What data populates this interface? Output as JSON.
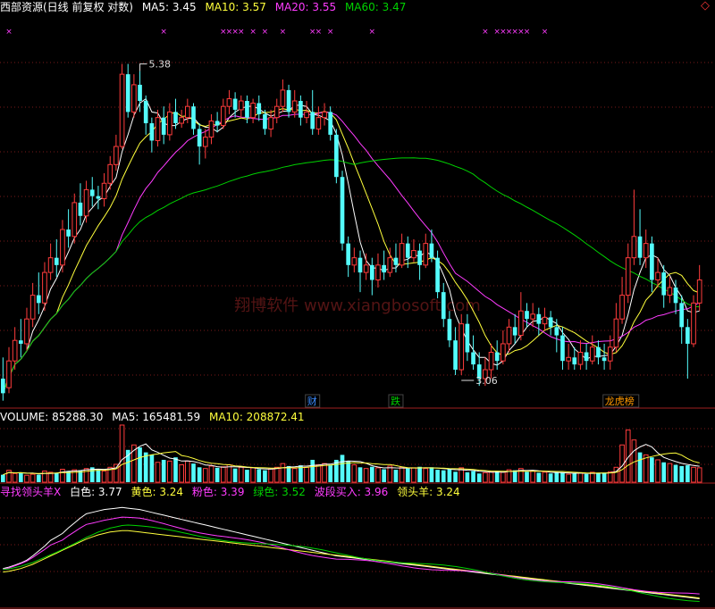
{
  "header": {
    "title": "西部资源(日线 前复权 对数)",
    "ma5": "MA5: 3.45",
    "ma10": "MA10: 3.57",
    "ma20": "MA20: 3.55",
    "ma60": "MA60: 3.47",
    "close_symbol": "◇"
  },
  "colors": {
    "up": "#ff3c3c",
    "down": "#54fcfc",
    "ma5": "#ffffff",
    "ma10": "#ffff3c",
    "ma20": "#ff3cff",
    "ma60": "#00d200",
    "grid": "#7a1a1a",
    "marker": "#ff3cff"
  },
  "annotations": {
    "high": "5.38",
    "low": "3.06",
    "watermark": "翔博软件 www.xiangbosoft.com",
    "tags": [
      {
        "text": "财",
        "color": "#3c8cff"
      },
      {
        "text": "跌",
        "color": "#00d200"
      },
      {
        "text": "龙虎榜",
        "color": "#ff9900"
      }
    ]
  },
  "volume_header": {
    "volume": "VOLUME: 85288.30",
    "ma5": "MA5: 165481.59",
    "ma10": "MA10: 208872.41"
  },
  "indicator_header": {
    "name": "寻找领头羊X",
    "white": "白色: 3.77",
    "yellow": "黄色: 3.24",
    "pink": "粉色: 3.39",
    "green": "绿色: 3.52",
    "wave_buy": "波段买入: 3.96",
    "leader": "领头羊: 3.24"
  },
  "chart_data": {
    "type": "candlestick",
    "scale": "log",
    "ylim": [
      2.95,
      5.9
    ],
    "grid": "dotted-horizontal",
    "marker_days": [
      1,
      27,
      37,
      38,
      39,
      40,
      42,
      44,
      47,
      52,
      53,
      55,
      62,
      81,
      83,
      84,
      85,
      86,
      87,
      88,
      91
    ],
    "high_label_day": 23,
    "low_label_day": 77,
    "tag_days": [
      52,
      66,
      102
    ],
    "candles": [
      [
        3.1,
        3.02,
        3.22,
        2.98
      ],
      [
        3.05,
        3.2,
        3.28,
        3.02
      ],
      [
        3.2,
        3.32,
        3.4,
        3.15
      ],
      [
        3.32,
        3.3,
        3.45,
        3.22
      ],
      [
        3.3,
        3.45,
        3.52,
        3.26
      ],
      [
        3.45,
        3.6,
        3.68,
        3.4
      ],
      [
        3.6,
        3.55,
        3.75,
        3.48
      ],
      [
        3.55,
        3.75,
        3.82,
        3.5
      ],
      [
        3.75,
        3.85,
        3.95,
        3.7
      ],
      [
        3.85,
        3.8,
        3.98,
        3.72
      ],
      [
        3.8,
        4.05,
        4.12,
        3.75
      ],
      [
        4.05,
        4.0,
        4.2,
        3.92
      ],
      [
        4.0,
        4.25,
        4.32,
        3.95
      ],
      [
        4.25,
        4.15,
        4.4,
        4.08
      ],
      [
        4.15,
        4.35,
        4.42,
        4.1
      ],
      [
        4.35,
        4.3,
        4.45,
        4.22
      ],
      [
        4.3,
        4.28,
        4.38,
        4.2
      ],
      [
        4.28,
        4.4,
        4.48,
        4.22
      ],
      [
        4.4,
        4.55,
        4.62,
        4.35
      ],
      [
        4.55,
        4.7,
        4.8,
        4.5
      ],
      [
        4.7,
        5.35,
        5.45,
        4.68
      ],
      [
        5.35,
        5.0,
        5.45,
        4.95
      ],
      [
        5.0,
        5.25,
        5.35,
        4.95
      ],
      [
        5.25,
        5.1,
        5.38,
        5.0
      ],
      [
        5.1,
        4.9,
        5.15,
        4.8
      ],
      [
        4.9,
        4.75,
        4.95,
        4.65
      ],
      [
        4.75,
        4.95,
        5.02,
        4.7
      ],
      [
        4.95,
        4.8,
        5.05,
        4.72
      ],
      [
        4.8,
        5.0,
        5.08,
        4.75
      ],
      [
        5.0,
        4.9,
        5.12,
        4.85
      ],
      [
        4.9,
        4.95,
        5.02,
        4.86
      ],
      [
        4.95,
        5.05,
        5.12,
        4.9
      ],
      [
        5.05,
        4.85,
        5.08,
        4.8
      ],
      [
        4.85,
        4.7,
        4.9,
        4.55
      ],
      [
        4.7,
        4.78,
        4.85,
        4.6
      ],
      [
        4.78,
        4.92,
        4.98,
        4.72
      ],
      [
        4.92,
        4.88,
        5.0,
        4.82
      ],
      [
        4.88,
        5.05,
        5.12,
        4.85
      ],
      [
        5.05,
        5.12,
        5.2,
        4.98
      ],
      [
        5.12,
        5.02,
        5.18,
        4.95
      ],
      [
        5.02,
        5.1,
        5.15,
        4.95
      ],
      [
        5.1,
        4.95,
        5.15,
        4.9
      ],
      [
        4.95,
        5.08,
        5.12,
        4.9
      ],
      [
        5.08,
        4.98,
        5.15,
        4.92
      ],
      [
        4.98,
        4.85,
        5.02,
        4.8
      ],
      [
        4.85,
        4.95,
        5.02,
        4.78
      ],
      [
        4.95,
        5.05,
        5.12,
        4.9
      ],
      [
        5.05,
        5.2,
        5.3,
        5.0
      ],
      [
        5.2,
        5.0,
        5.25,
        4.95
      ],
      [
        5.0,
        5.1,
        5.2,
        4.95
      ],
      [
        5.1,
        4.95,
        5.15,
        4.88
      ],
      [
        4.95,
        5.0,
        5.1,
        4.9
      ],
      [
        5.0,
        4.85,
        5.2,
        4.8
      ],
      [
        4.85,
        4.95,
        5.05,
        4.8
      ],
      [
        4.95,
        5.0,
        5.08,
        4.88
      ],
      [
        5.0,
        4.8,
        5.05,
        4.75
      ],
      [
        4.8,
        4.45,
        4.85,
        4.4
      ],
      [
        4.45,
        3.95,
        4.5,
        3.9
      ],
      [
        3.95,
        3.8,
        4.0,
        3.72
      ],
      [
        3.8,
        3.85,
        3.92,
        3.75
      ],
      [
        3.85,
        3.75,
        3.9,
        3.62
      ],
      [
        3.75,
        3.8,
        3.88,
        3.7
      ],
      [
        3.8,
        3.7,
        3.85,
        3.6
      ],
      [
        3.7,
        3.8,
        3.88,
        3.65
      ],
      [
        3.8,
        3.75,
        3.9,
        3.7
      ],
      [
        3.75,
        3.85,
        3.92,
        3.72
      ],
      [
        3.85,
        3.8,
        3.95,
        3.75
      ],
      [
        3.8,
        3.95,
        4.02,
        3.78
      ],
      [
        3.95,
        3.85,
        4.0,
        3.78
      ],
      [
        3.85,
        3.9,
        3.98,
        3.82
      ],
      [
        3.9,
        3.8,
        3.95,
        3.7
      ],
      [
        3.8,
        3.95,
        4.02,
        3.78
      ],
      [
        3.95,
        3.85,
        4.05,
        3.82
      ],
      [
        3.85,
        3.62,
        3.9,
        3.58
      ],
      [
        3.62,
        3.45,
        3.68,
        3.4
      ],
      [
        3.45,
        3.32,
        3.5,
        3.28
      ],
      [
        3.32,
        3.15,
        3.4,
        3.12
      ],
      [
        3.15,
        3.42,
        3.48,
        3.12
      ],
      [
        3.42,
        3.25,
        3.48,
        3.2
      ],
      [
        3.25,
        3.18,
        3.35,
        3.15
      ],
      [
        3.18,
        3.1,
        3.25,
        3.06
      ],
      [
        3.1,
        3.15,
        3.22,
        3.06
      ],
      [
        3.15,
        3.25,
        3.3,
        3.1
      ],
      [
        3.25,
        3.2,
        3.32,
        3.15
      ],
      [
        3.2,
        3.3,
        3.38,
        3.18
      ],
      [
        3.3,
        3.4,
        3.45,
        3.25
      ],
      [
        3.4,
        3.35,
        3.48,
        3.3
      ],
      [
        3.35,
        3.5,
        3.62,
        3.32
      ],
      [
        3.5,
        3.45,
        3.55,
        3.4
      ],
      [
        3.45,
        3.48,
        3.55,
        3.4
      ],
      [
        3.48,
        3.42,
        3.52,
        3.35
      ],
      [
        3.42,
        3.46,
        3.52,
        3.38
      ],
      [
        3.46,
        3.4,
        3.5,
        3.35
      ],
      [
        3.4,
        3.35,
        3.45,
        3.25
      ],
      [
        3.35,
        3.2,
        3.4,
        3.15
      ],
      [
        3.2,
        3.22,
        3.3,
        3.15
      ],
      [
        3.22,
        3.18,
        3.28,
        3.15
      ],
      [
        3.18,
        3.25,
        3.32,
        3.15
      ],
      [
        3.25,
        3.2,
        3.3,
        3.15
      ],
      [
        3.2,
        3.28,
        3.35,
        3.18
      ],
      [
        3.28,
        3.22,
        3.32,
        3.18
      ],
      [
        3.22,
        3.2,
        3.3,
        3.15
      ],
      [
        3.2,
        3.28,
        3.35,
        3.15
      ],
      [
        3.28,
        3.45,
        3.55,
        3.25
      ],
      [
        3.45,
        3.6,
        3.72,
        3.42
      ],
      [
        3.6,
        3.85,
        3.95,
        3.55
      ],
      [
        3.85,
        4.0,
        4.35,
        3.8
      ],
      [
        4.0,
        3.85,
        4.2,
        3.8
      ],
      [
        3.85,
        3.95,
        4.05,
        3.78
      ],
      [
        3.95,
        3.7,
        4.0,
        3.62
      ],
      [
        3.7,
        3.75,
        3.85,
        3.65
      ],
      [
        3.75,
        3.6,
        3.8,
        3.52
      ],
      [
        3.6,
        3.65,
        3.72,
        3.55
      ],
      [
        3.65,
        3.55,
        3.7,
        3.48
      ],
      [
        3.55,
        3.4,
        3.6,
        3.3
      ],
      [
        3.4,
        3.3,
        3.45,
        3.1
      ],
      [
        3.3,
        3.55,
        3.6,
        3.28
      ],
      [
        3.55,
        3.7,
        3.8,
        3.5
      ]
    ],
    "volume": [
      30,
      48,
      35,
      40,
      28,
      32,
      30,
      45,
      40,
      38,
      52,
      45,
      50,
      48,
      55,
      60,
      50,
      45,
      60,
      72,
      230,
      130,
      150,
      140,
      120,
      110,
      80,
      90,
      85,
      100,
      70,
      85,
      75,
      60,
      55,
      65,
      58,
      62,
      70,
      55,
      60,
      50,
      58,
      52,
      48,
      55,
      60,
      75,
      65,
      55,
      68,
      60,
      90,
      70,
      75,
      68,
      90,
      110,
      85,
      70,
      60,
      55,
      62,
      58,
      52,
      65,
      50,
      60,
      55,
      58,
      62,
      55,
      60,
      50,
      48,
      52,
      42,
      58,
      40,
      45,
      35,
      38,
      42,
      45,
      40,
      50,
      48,
      55,
      42,
      45,
      38,
      40,
      35,
      38,
      40,
      32,
      35,
      38,
      33,
      40,
      36,
      38,
      42,
      60,
      150,
      210,
      170,
      120,
      110,
      100,
      90,
      80,
      75,
      70,
      65,
      68,
      60,
      58
    ],
    "indicator": {
      "white": [
        0.1,
        0.12,
        0.15,
        0.18,
        0.22,
        0.28,
        0.35,
        0.42,
        0.5,
        0.55,
        0.6,
        0.68,
        0.75,
        0.82,
        0.88,
        0.9,
        0.92,
        0.94,
        0.95,
        0.96,
        0.97,
        0.96,
        0.95,
        0.94,
        0.92,
        0.9,
        0.88,
        0.86,
        0.84,
        0.82,
        0.8,
        0.78,
        0.76,
        0.74,
        0.72,
        0.7,
        0.68,
        0.66,
        0.64,
        0.62,
        0.6,
        0.58,
        0.56,
        0.54,
        0.52,
        0.5,
        0.48,
        0.46,
        0.44,
        0.42,
        0.4,
        0.38,
        0.36,
        0.34,
        0.32,
        0.3,
        0.28,
        0.27,
        0.26,
        0.25,
        0.24,
        0.23,
        0.22,
        0.21,
        0.2,
        0.19,
        0.18,
        0.17,
        0.16,
        0.15,
        0.14,
        0.13,
        0.12,
        0.11,
        0.1,
        0.09,
        0.08,
        0.07,
        0.06,
        0.05,
        0.04,
        0.03,
        0.02,
        0.01,
        0.0,
        -0.01,
        -0.02,
        -0.03,
        -0.04,
        -0.05,
        -0.06,
        -0.07,
        -0.08,
        -0.09,
        -0.1,
        -0.11,
        -0.12,
        -0.13,
        -0.14,
        -0.15,
        -0.16,
        -0.17,
        -0.18,
        -0.19,
        -0.2,
        -0.21,
        -0.22,
        -0.23,
        -0.24,
        -0.25,
        -0.26,
        -0.27,
        -0.28,
        -0.29,
        -0.3,
        -0.31,
        -0.32,
        -0.33
      ],
      "yellow": [
        0.05,
        0.06,
        0.08,
        0.1,
        0.13,
        0.16,
        0.2,
        0.24,
        0.28,
        0.32,
        0.36,
        0.4,
        0.44,
        0.48,
        0.52,
        0.55,
        0.58,
        0.6,
        0.62,
        0.63,
        0.64,
        0.64,
        0.63,
        0.62,
        0.61,
        0.6,
        0.59,
        0.58,
        0.57,
        0.56,
        0.55,
        0.54,
        0.53,
        0.52,
        0.51,
        0.5,
        0.49,
        0.48,
        0.47,
        0.46,
        0.45,
        0.44,
        0.43,
        0.42,
        0.41,
        0.4,
        0.39,
        0.38,
        0.37,
        0.36,
        0.35,
        0.34,
        0.33,
        0.32,
        0.31,
        0.3,
        0.29,
        0.28,
        0.27,
        0.26,
        0.25,
        0.24,
        0.23,
        0.22,
        0.21,
        0.2,
        0.19,
        0.18,
        0.17,
        0.16,
        0.15,
        0.14,
        0.13,
        0.12,
        0.11,
        0.1,
        0.09,
        0.08,
        0.07,
        0.06,
        0.05,
        0.04,
        0.03,
        0.02,
        0.01,
        0.0,
        -0.01,
        -0.02,
        -0.03,
        -0.04,
        -0.05,
        -0.06,
        -0.07,
        -0.08,
        -0.09,
        -0.1,
        -0.11,
        -0.12,
        -0.13,
        -0.14,
        -0.15,
        -0.16,
        -0.17,
        -0.18,
        -0.19,
        -0.2,
        -0.21,
        -0.22,
        -0.23,
        -0.24,
        -0.25,
        -0.26,
        -0.27,
        -0.28,
        -0.29,
        -0.3,
        -0.31,
        -0.32
      ]
    }
  }
}
